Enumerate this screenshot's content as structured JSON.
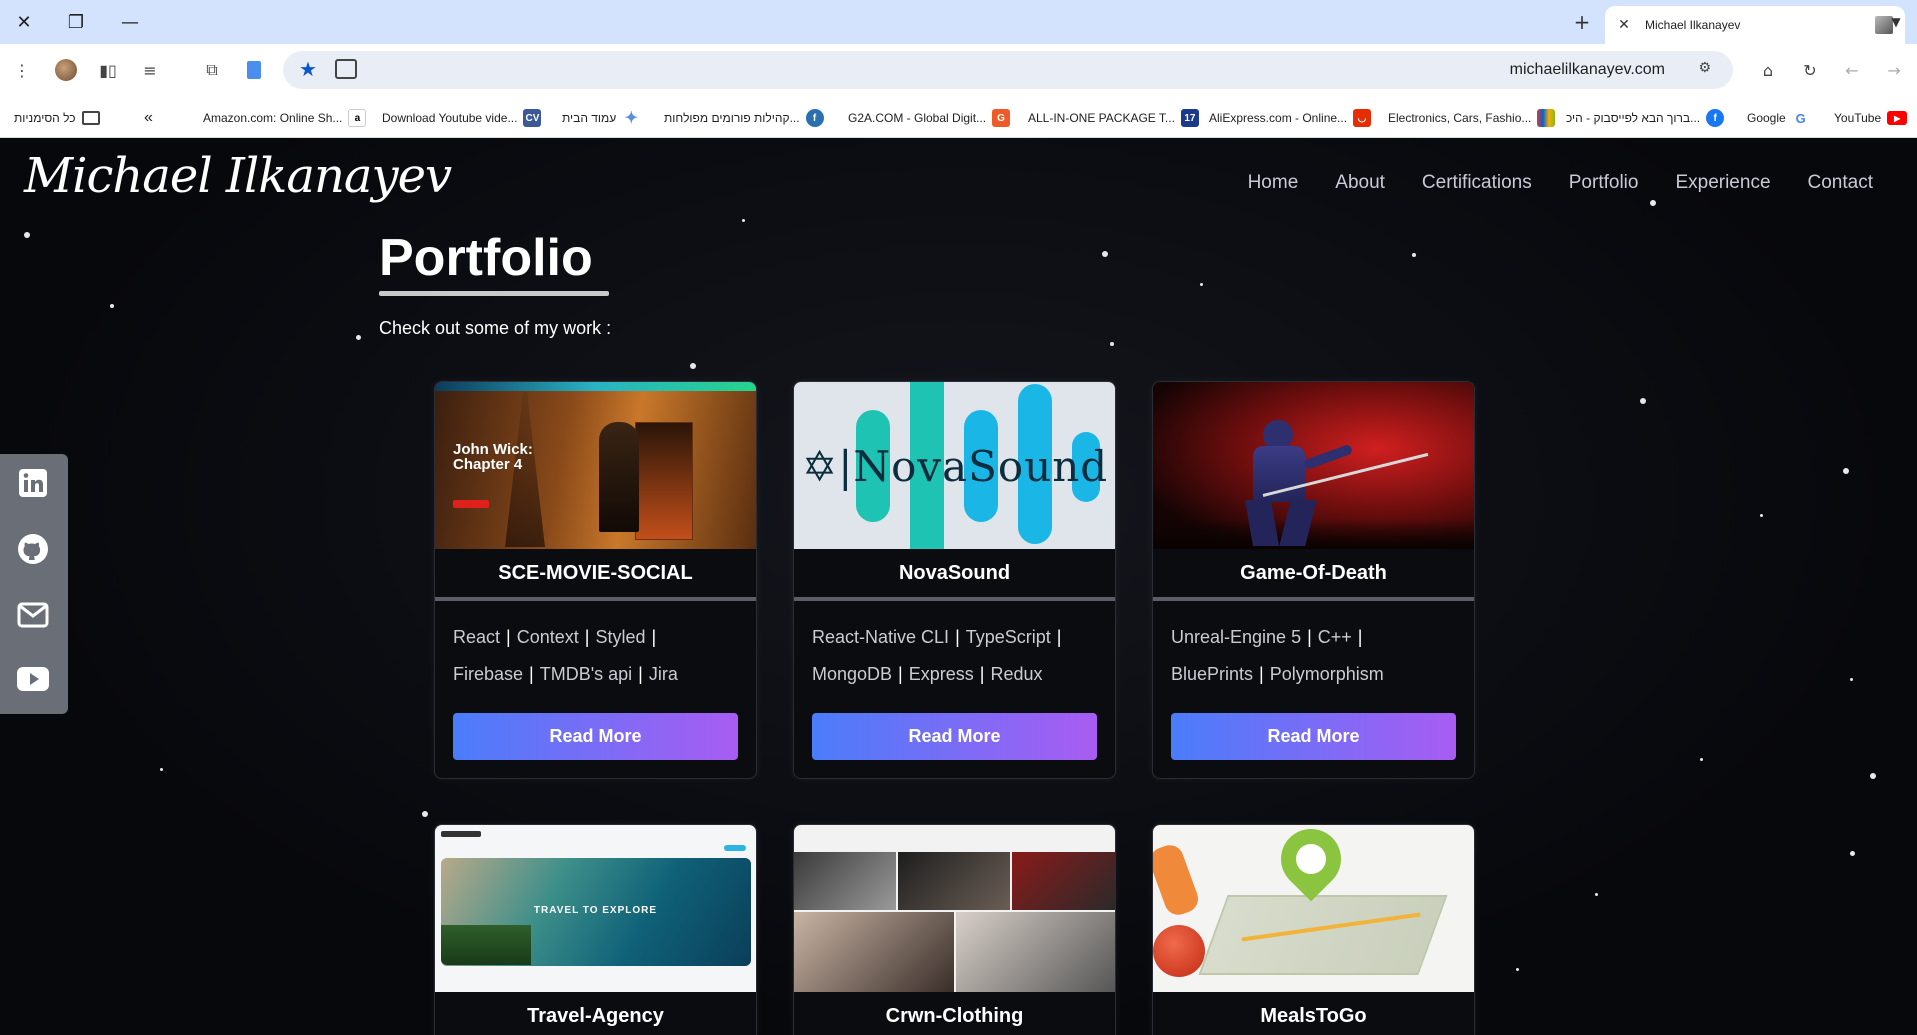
{
  "browser": {
    "tab_title": "Michael Ilkanayev",
    "url": "michaelilkanayev.com",
    "bookmarks_folder": "כל הסימניות",
    "bookmarks": [
      {
        "label": "Amazon.com: Online Sh...",
        "icon": "amazon-icon",
        "color": "#ffffff"
      },
      {
        "label": "Download Youtube vide...",
        "icon": "cv-icon",
        "color": "#3b5998"
      },
      {
        "label": "עמוד הבית",
        "icon": "sparkle-icon",
        "color": "#5a8fd8"
      },
      {
        "label": "קהילות פורומים מפולחות...",
        "icon": "fxp-icon",
        "color": "#2a6fb0"
      },
      {
        "label": "G2A.COM - Global Digit...",
        "icon": "g2a-icon",
        "color": "#f05a28"
      },
      {
        "label": "ALL-IN-ONE PACKAGE T...",
        "icon": "17-icon",
        "color": "#1b3a8c"
      },
      {
        "label": "AliExpress.com - Online...",
        "icon": "aliexpress-icon",
        "color": "#e62e04"
      },
      {
        "label": "Electronics, Cars, Fashio...",
        "icon": "ebay-icon",
        "color": "#86b817"
      },
      {
        "label": "ברוך הבא לפייסבוק - היכ...",
        "icon": "facebook-icon",
        "color": "#1877f2"
      },
      {
        "label": "Google",
        "icon": "google-icon",
        "color": "#4285f4"
      },
      {
        "label": "YouTube",
        "icon": "youtube-icon",
        "color": "#ff0000"
      }
    ]
  },
  "site": {
    "logo": "Michael Ilkanayev",
    "nav": [
      "Home",
      "About",
      "Certifications",
      "Portfolio",
      "Experience",
      "Contact"
    ],
    "heading": "Portfolio",
    "subtitle": "Check out some of my work :",
    "social": [
      "linkedin-icon",
      "github-icon",
      "mail-icon",
      "youtube-icon"
    ]
  },
  "projects": [
    {
      "title": "SCE-MOVIE-SOCIAL",
      "tags_line1": [
        "React",
        "Context",
        "Styled"
      ],
      "tags_line2": [
        "Firebase",
        "TMDB's api",
        "Jira"
      ],
      "button": "Read More",
      "thumb_text": "John Wick: Chapter 4"
    },
    {
      "title": "NovaSound",
      "tags_line1": [
        "React-Native CLI",
        "TypeScript"
      ],
      "tags_line2": [
        "MongoDB",
        "Express",
        "Redux"
      ],
      "button": "Read More",
      "thumb_text": "NovaSound"
    },
    {
      "title": "Game-Of-Death",
      "tags_line1": [
        "Unreal-Engine 5",
        "C++"
      ],
      "tags_line2": [
        "BluePrints",
        "Polymorphism"
      ],
      "button": "Read More",
      "thumb_text": ""
    },
    {
      "title": "Travel-Agency",
      "thumb_text": "TRAVEL TO EXPLORE"
    },
    {
      "title": "Crwn-Clothing",
      "thumb_text": ""
    },
    {
      "title": "MealsToGo",
      "thumb_text": ""
    }
  ]
}
